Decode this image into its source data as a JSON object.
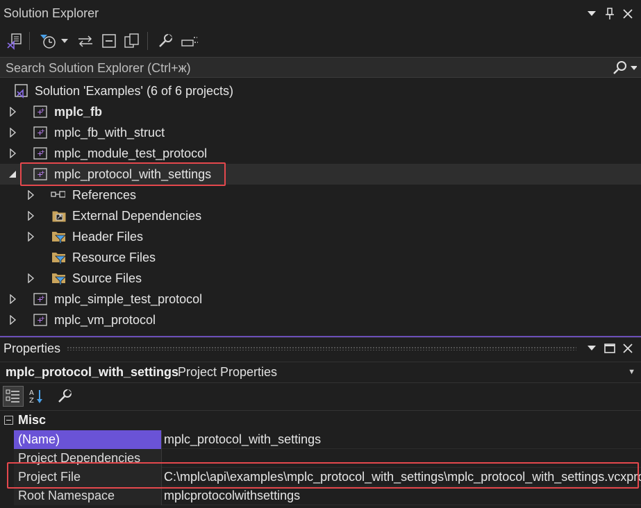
{
  "solution_explorer": {
    "title": "Solution Explorer",
    "search_placeholder": "Search Solution Explorer (Ctrl+ж)",
    "solution_label": "Solution 'Examples' (6 of 6 projects)",
    "nodes": [
      {
        "label": "mplc_fb",
        "bold": true,
        "expanded": false
      },
      {
        "label": "mplc_fb_with_struct",
        "expanded": false
      },
      {
        "label": "mplc_module_test_protocol",
        "expanded": false
      },
      {
        "label": "mplc_protocol_with_settings",
        "expanded": true,
        "selected": true
      },
      {
        "label": "References",
        "icon": "references-icon"
      },
      {
        "label": "External Dependencies",
        "icon": "external-dependencies-icon"
      },
      {
        "label": "Header Files",
        "icon": "filter-folder-icon"
      },
      {
        "label": "Resource Files",
        "icon": "filter-folder-icon"
      },
      {
        "label": "Source Files",
        "icon": "filter-folder-icon"
      },
      {
        "label": "mplc_simple_test_protocol",
        "expanded": false
      },
      {
        "label": "mplc_vm_protocol",
        "expanded": false
      }
    ]
  },
  "properties": {
    "title": "Properties",
    "object_name": "mplc_protocol_with_settings",
    "object_type": "Project Properties",
    "category": "Misc",
    "rows": [
      {
        "name": "(Name)",
        "value": "mplc_protocol_with_settings"
      },
      {
        "name": "Project Dependencies",
        "value": ""
      },
      {
        "name": "Project File",
        "value": "C:\\mplc\\api\\examples\\mplc_protocol_with_settings\\mplc_protocol_with_settings.vcxproj"
      },
      {
        "name": "Root Namespace",
        "value": "mplcprotocolwithsettings"
      }
    ]
  },
  "colors": {
    "accent": "#6a53d6",
    "highlight_border": "#e5484d",
    "vs_purple": "#8b6ee8"
  }
}
